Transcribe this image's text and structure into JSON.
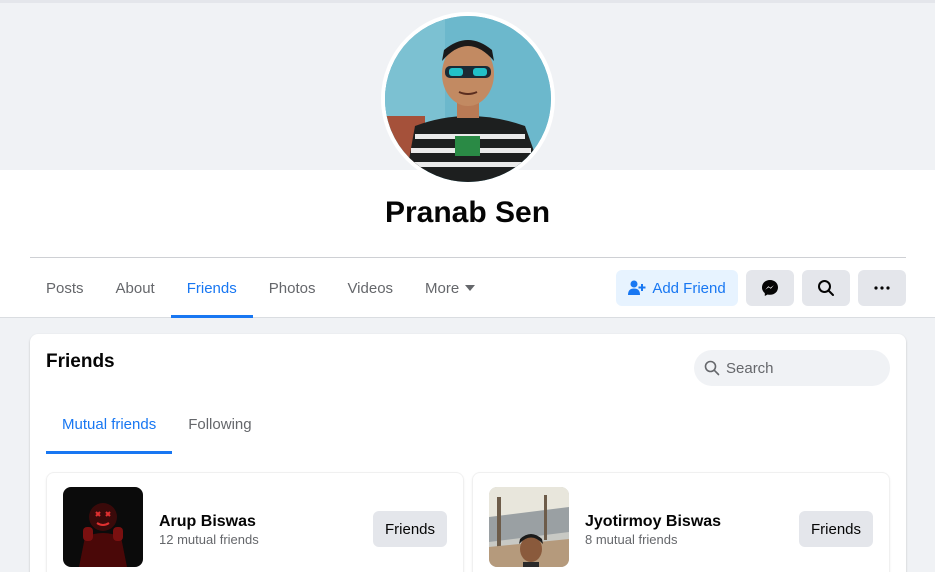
{
  "profile": {
    "name": "Pranab Sen"
  },
  "nav": {
    "tabs": [
      {
        "label": "Posts"
      },
      {
        "label": "About"
      },
      {
        "label": "Friends"
      },
      {
        "label": "Photos"
      },
      {
        "label": "Videos"
      },
      {
        "label": "More"
      }
    ],
    "active_tab": "Friends"
  },
  "actions": {
    "add_friend_label": "Add Friend",
    "messenger_icon": "messenger-icon",
    "search_icon": "search-icon",
    "more_icon": "more-horizontal-icon"
  },
  "friends_section": {
    "title": "Friends",
    "search_placeholder": "Search",
    "subtabs": [
      {
        "label": "Mutual friends"
      },
      {
        "label": "Following"
      }
    ],
    "active_subtab": "Mutual friends",
    "list": [
      {
        "name": "Arup Biswas",
        "mutual": "12 mutual friends",
        "button": "Friends"
      },
      {
        "name": "Jyotirmoy Biswas",
        "mutual": "8 mutual friends",
        "button": "Friends"
      }
    ]
  },
  "colors": {
    "accent": "#1877f2",
    "background": "#f0f2f5",
    "secondary_button": "#e4e6eb"
  }
}
